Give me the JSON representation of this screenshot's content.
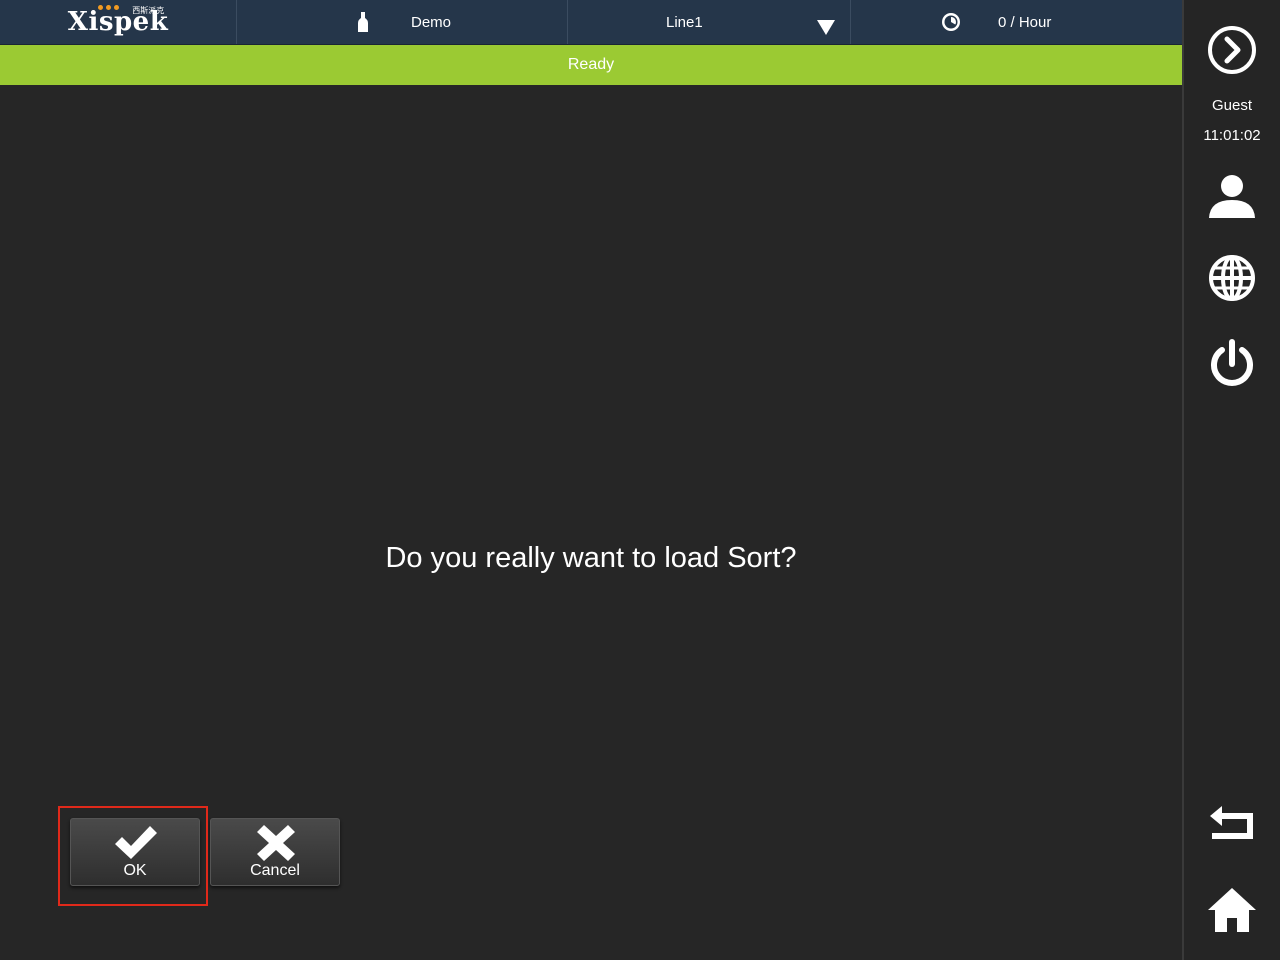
{
  "header": {
    "logo_text": "Xispek",
    "logo_subtext": "西斯派克",
    "recipe": "Demo",
    "line": "Line1",
    "rate": "0 / Hour"
  },
  "status": {
    "text": "Ready",
    "color": "#9bca33"
  },
  "sidebar": {
    "user": "Guest",
    "time": "11:01:02"
  },
  "dialog": {
    "message": "Do you really want to load Sort?",
    "ok_label": "OK",
    "cancel_label": "Cancel"
  },
  "icons": {
    "recipe": "bottle-icon",
    "line_dropdown": "chevron-down-icon",
    "rate": "clock-icon",
    "next": "arrow-right-circle-icon",
    "user": "user-icon",
    "language": "globe-icon",
    "power": "power-icon",
    "back": "back-arrow-icon",
    "home": "home-icon"
  },
  "colors": {
    "header_bg": "#25364a",
    "highlight": "#e0291a"
  }
}
